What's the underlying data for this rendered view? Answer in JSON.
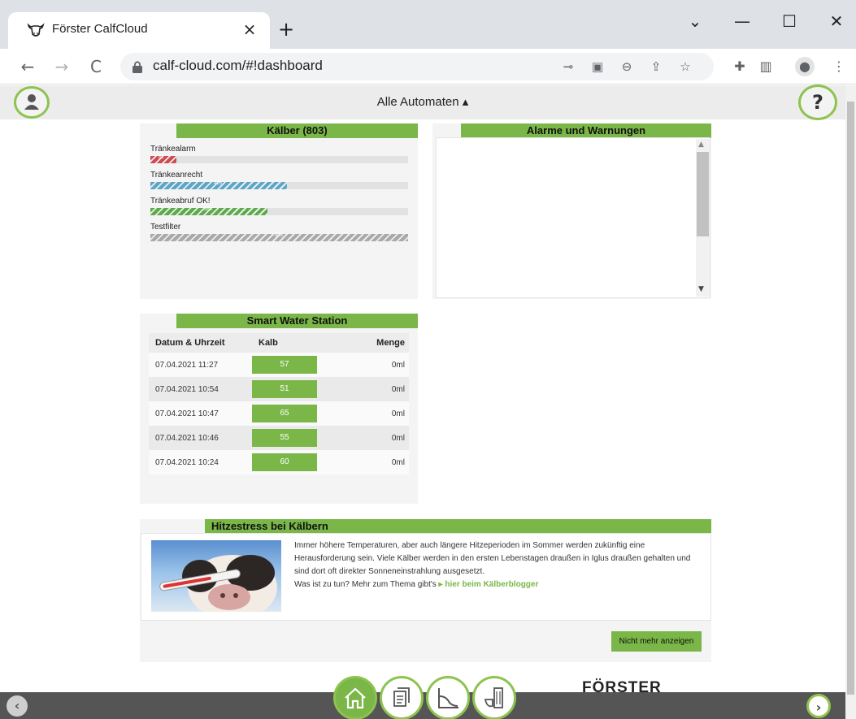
{
  "browser": {
    "tab_title": "Förster CalfCloud",
    "tab_close": "×",
    "new_tab": "+",
    "url": "calf-cloud.com/#!dashboard",
    "window_controls": {
      "minimize": "—",
      "maximize": "☐",
      "close": "✕",
      "tab_search": "⌄"
    },
    "nav": {
      "back": "←",
      "forward": "→",
      "reload": "C"
    },
    "toolbar_icons": [
      "key-icon",
      "translate-icon",
      "zoom-out-icon",
      "share-icon",
      "star-icon",
      "extensions-icon",
      "side-panel-icon",
      "profile-icon",
      "menu-icon"
    ]
  },
  "app": {
    "header_title": "Alle Automaten ▴",
    "help_label": "?",
    "calves_panel": {
      "title": "Kälber (803)",
      "bars": [
        {
          "label": "Tränkealarm",
          "count": "82",
          "fraction": 0.102,
          "color": "#d04a4f"
        },
        {
          "label": "Tränkeanrecht",
          "count": "426",
          "fraction": 0.53,
          "color": "#5aa6c8"
        },
        {
          "label": "Tränkeabruf OK!",
          "count": "364",
          "fraction": 0.453,
          "color": "#5cab4a"
        },
        {
          "label": "Testfilter",
          "count": "803",
          "fraction": 1.0,
          "color": "#a8a8a8"
        }
      ]
    },
    "alarms_panel": {
      "title": "Alarme und Warnungen"
    },
    "water_panel": {
      "title": "Smart Water Station",
      "columns": [
        "Datum & Uhrzeit",
        "Kalb",
        "Menge"
      ],
      "rows": [
        {
          "datetime": "07.04.2021 11:27",
          "calf": "57",
          "amount": "0ml"
        },
        {
          "datetime": "07.04.2021 10:54",
          "calf": "51",
          "amount": "0ml"
        },
        {
          "datetime": "07.04.2021 10:47",
          "calf": "65",
          "amount": "0ml"
        },
        {
          "datetime": "07.04.2021 10:46",
          "calf": "55",
          "amount": "0ml"
        },
        {
          "datetime": "07.04.2021 10:24",
          "calf": "60",
          "amount": "0ml"
        }
      ]
    },
    "news_panel": {
      "title": "Hitzestress bei Kälbern",
      "text": "Immer höhere Temperaturen, aber auch längere Hitzeperioden im Sommer werden zukünftig eine Herausforderung sein. Viele Kälber werden in den ersten Lebenstagen draußen in Iglus draußen gehalten und sind dort oft direkter Sonneneinstrahlung ausgesetzt.",
      "question": "Was ist zu tun? Mehr zum Thema gibt's",
      "link": "▸ hier beim Kälberblogger",
      "dismiss": "Nicht mehr anzeigen"
    },
    "bottom_nav": [
      "home-icon",
      "documents-icon",
      "chart-icon",
      "feeder-icon"
    ],
    "brand": "FÖRSTER",
    "prev": "‹",
    "next": "›"
  }
}
